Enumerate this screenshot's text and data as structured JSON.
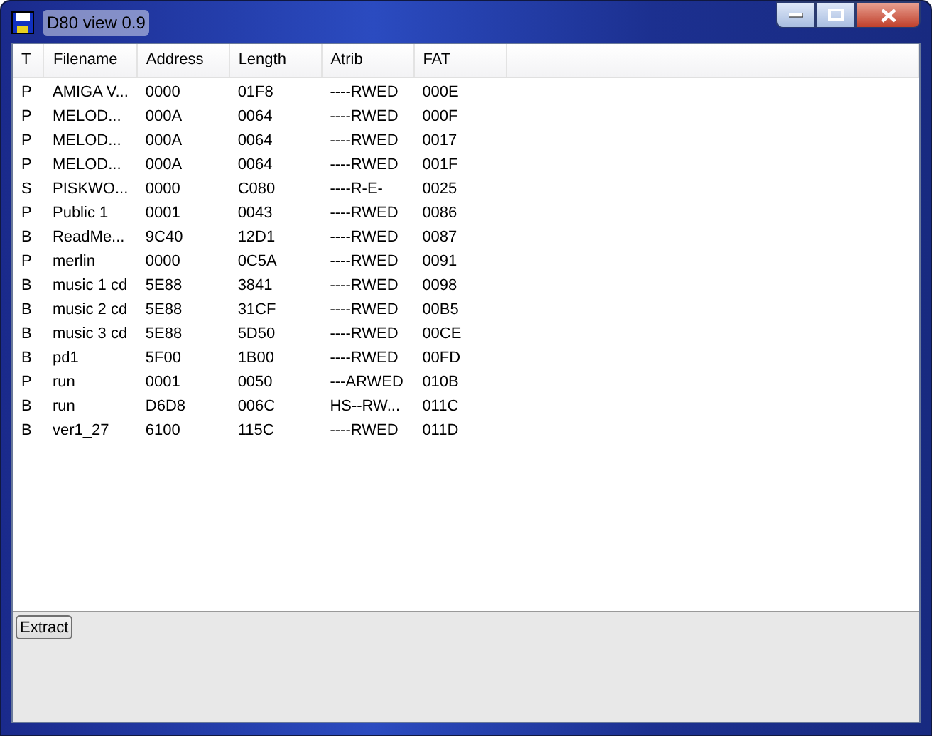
{
  "window": {
    "title": "D80 view 0.9"
  },
  "table": {
    "columns": [
      "T",
      "Filename",
      "Address",
      "Length",
      "Atrib",
      "FAT"
    ],
    "rows": [
      [
        "P",
        "AMIGA V...",
        "0000",
        "01F8",
        "----RWED",
        "000E"
      ],
      [
        "P",
        "MELOD...",
        "000A",
        "0064",
        "----RWED",
        "000F"
      ],
      [
        "P",
        "MELOD...",
        "000A",
        "0064",
        "----RWED",
        "0017"
      ],
      [
        "P",
        "MELOD...",
        "000A",
        "0064",
        "----RWED",
        "001F"
      ],
      [
        "S",
        "PISKWO...",
        "0000",
        "C080",
        "----R-E-",
        "0025"
      ],
      [
        "P",
        "Public 1",
        "0001",
        "0043",
        "----RWED",
        "0086"
      ],
      [
        "B",
        "ReadMe...",
        "9C40",
        "12D1",
        "----RWED",
        "0087"
      ],
      [
        "P",
        "merlin",
        "0000",
        "0C5A",
        "----RWED",
        "0091"
      ],
      [
        "B",
        "music 1 cd",
        "5E88",
        "3841",
        "----RWED",
        "0098"
      ],
      [
        "B",
        "music 2 cd",
        "5E88",
        "31CF",
        "----RWED",
        "00B5"
      ],
      [
        "B",
        "music 3 cd",
        "5E88",
        "5D50",
        "----RWED",
        "00CE"
      ],
      [
        "B",
        "pd1",
        "5F00",
        "1B00",
        "----RWED",
        "00FD"
      ],
      [
        "P",
        "run",
        "0001",
        "0050",
        "---ARWED",
        "010B"
      ],
      [
        "B",
        "run",
        "D6D8",
        "006C",
        "HS--RW...",
        "011C"
      ],
      [
        "B",
        "ver1_27",
        "6100",
        "115C",
        "----RWED",
        "011D"
      ]
    ]
  },
  "buttons": [
    "Extract"
  ]
}
